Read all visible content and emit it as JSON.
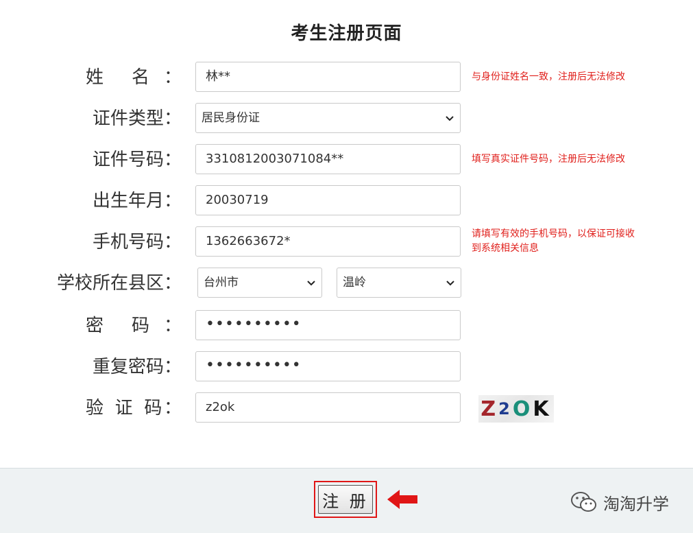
{
  "page_title": "考生注册页面",
  "fields": {
    "name": {
      "label_chars": [
        "姓",
        "名",
        "："
      ],
      "value": "林**",
      "hint": "与身份证姓名一致，注册后无法修改"
    },
    "id_type": {
      "label": "证件类型：",
      "selected": "居民身份证"
    },
    "id_number": {
      "label": "证件号码：",
      "value": "3310812003071084**",
      "hint": "填写真实证件号码，注册后无法修改"
    },
    "birth": {
      "label": "出生年月：",
      "value": "20030719"
    },
    "phone": {
      "label": "手机号码：",
      "value": "1362663672*",
      "hint_line1": "请填写有效的手机号码，以保证可接收",
      "hint_line2": "到系统相关信息"
    },
    "county": {
      "label": "学校所在县区：",
      "city": "台州市",
      "district": "温岭"
    },
    "password": {
      "label_chars": [
        "密",
        "码",
        "："
      ],
      "value": "••••••••••"
    },
    "password_repeat": {
      "label": "重复密码：",
      "value": "••••••••••"
    },
    "captcha": {
      "label_chars": [
        "验",
        "证",
        "码",
        "："
      ],
      "value": "z2ok",
      "image_text": [
        "Z",
        "2",
        "O",
        "K"
      ]
    }
  },
  "submit_label": "注 册",
  "brand": "淘淘升学",
  "colors": {
    "hint": "#e0201c",
    "highlight": "#e01616",
    "footer_bg": "#eef2f3"
  },
  "icons": {
    "select_arrow": "chevron-down-icon",
    "pointer": "arrow-left-icon",
    "brand_logo": "wechat-icon"
  }
}
